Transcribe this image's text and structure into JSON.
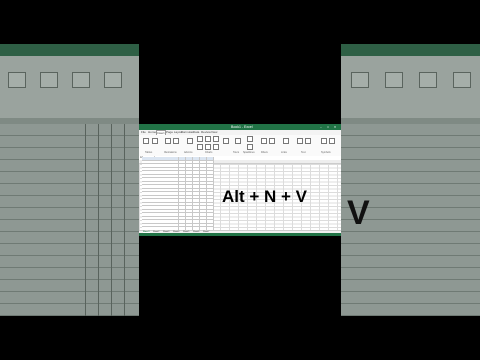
{
  "overlay": {
    "shortcut": "Alt + N + V"
  },
  "background_right": {
    "letter": "V"
  },
  "excel": {
    "title": "Book1 - Excel",
    "window_controls": [
      "–",
      "□",
      "✕"
    ],
    "tabs": [
      {
        "label": "File"
      },
      {
        "label": "Home"
      },
      {
        "label": "Insert"
      },
      {
        "label": "Page Layout"
      },
      {
        "label": "Formulas"
      },
      {
        "label": "Data"
      },
      {
        "label": "Review"
      },
      {
        "label": "View"
      }
    ],
    "active_tab": "Insert",
    "ribbon_groups": [
      "Tables",
      "Illustrations",
      "Add-ins",
      "Charts",
      "Tours",
      "Sparklines",
      "Filters",
      "Links",
      "Text",
      "Symbols"
    ],
    "name_box": "A1",
    "sheet_tabs": [
      "Sheet1",
      "Sheet2",
      "Sheet3",
      "Sheet4",
      "Sheet5",
      "Sheet6",
      "Sheet7"
    ],
    "active_sheet": "Sheet1",
    "table_row_count": 21,
    "accent": "#217346"
  }
}
